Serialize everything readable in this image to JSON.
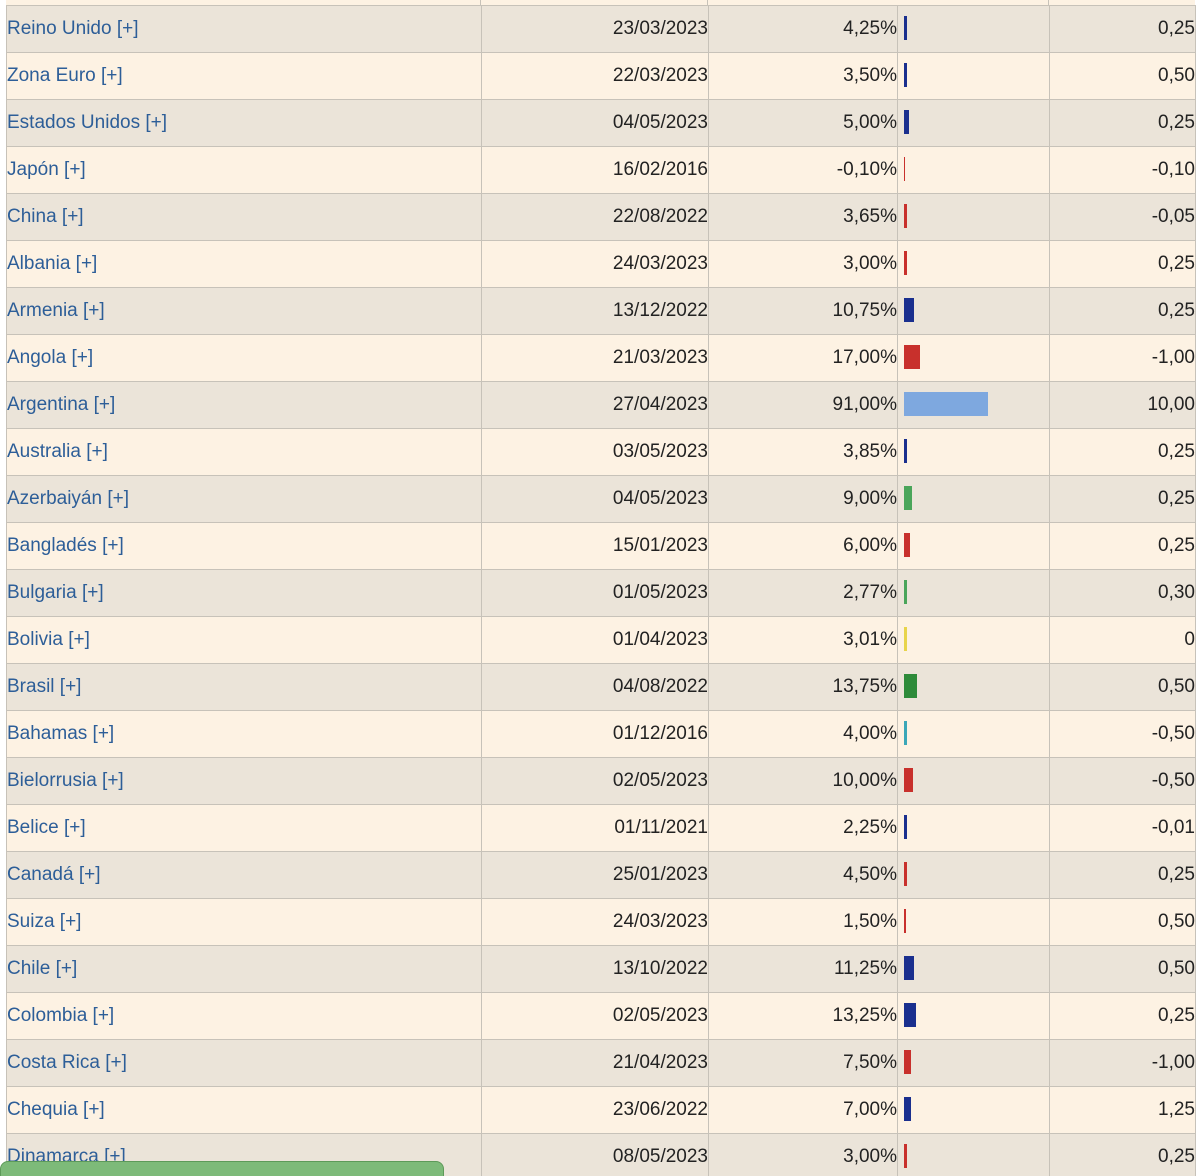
{
  "rows": [
    {
      "country": "Reino Unido [+]",
      "date": "23/03/2023",
      "rate": "4,25%",
      "rate_value": 4.25,
      "bar_color": "#1a2f8e",
      "change": "0,25",
      "dir": "pos"
    },
    {
      "country": "Zona Euro [+]",
      "date": "22/03/2023",
      "rate": "3,50%",
      "rate_value": 3.5,
      "bar_color": "#1a2f8e",
      "change": "0,50",
      "dir": "pos"
    },
    {
      "country": "Estados Unidos [+]",
      "date": "04/05/2023",
      "rate": "5,00%",
      "rate_value": 5.0,
      "bar_color": "#1a2f8e",
      "change": "0,25",
      "dir": "pos"
    },
    {
      "country": "Japón [+]",
      "date": "16/02/2016",
      "rate": "-0,10%",
      "rate_value": -0.1,
      "bar_color": "#c8302c",
      "change": "-0,10",
      "dir": "neg"
    },
    {
      "country": "China [+]",
      "date": "22/08/2022",
      "rate": "3,65%",
      "rate_value": 3.65,
      "bar_color": "#c8302c",
      "change": "-0,05",
      "dir": "neg"
    },
    {
      "country": "Albania [+]",
      "date": "24/03/2023",
      "rate": "3,00%",
      "rate_value": 3.0,
      "bar_color": "#c8302c",
      "change": "0,25",
      "dir": "pos"
    },
    {
      "country": "Armenia [+]",
      "date": "13/12/2022",
      "rate": "10,75%",
      "rate_value": 10.75,
      "bar_color": "#1a2f8e",
      "change": "0,25",
      "dir": "pos"
    },
    {
      "country": "Angola [+]",
      "date": "21/03/2023",
      "rate": "17,00%",
      "rate_value": 17.0,
      "bar_color": "#c8302c",
      "change": "-1,00",
      "dir": "neg"
    },
    {
      "country": "Argentina [+]",
      "date": "27/04/2023",
      "rate": "91,00%",
      "rate_value": 91.0,
      "bar_color": "#7ea8df",
      "change": "10,00",
      "dir": "pos"
    },
    {
      "country": "Australia [+]",
      "date": "03/05/2023",
      "rate": "3,85%",
      "rate_value": 3.85,
      "bar_color": "#1a2f8e",
      "change": "0,25",
      "dir": "pos"
    },
    {
      "country": "Azerbaiyán [+]",
      "date": "04/05/2023",
      "rate": "9,00%",
      "rate_value": 9.0,
      "bar_color": "#4aa55a",
      "change": "0,25",
      "dir": "pos"
    },
    {
      "country": "Bangladés [+]",
      "date": "15/01/2023",
      "rate": "6,00%",
      "rate_value": 6.0,
      "bar_color": "#c8302c",
      "change": "0,25",
      "dir": "pos"
    },
    {
      "country": "Bulgaria [+]",
      "date": "01/05/2023",
      "rate": "2,77%",
      "rate_value": 2.77,
      "bar_color": "#4aa55a",
      "change": "0,30",
      "dir": "pos"
    },
    {
      "country": "Bolivia [+]",
      "date": "01/04/2023",
      "rate": "3,01%",
      "rate_value": 3.01,
      "bar_color": "#e8d44a",
      "change": "0",
      "dir": "zero"
    },
    {
      "country": "Brasil [+]",
      "date": "04/08/2022",
      "rate": "13,75%",
      "rate_value": 13.75,
      "bar_color": "#2e8b3a",
      "change": "0,50",
      "dir": "pos"
    },
    {
      "country": "Bahamas [+]",
      "date": "01/12/2016",
      "rate": "4,00%",
      "rate_value": 4.0,
      "bar_color": "#3ba7b8",
      "change": "-0,50",
      "dir": "neg"
    },
    {
      "country": "Bielorrusia [+]",
      "date": "02/05/2023",
      "rate": "10,00%",
      "rate_value": 10.0,
      "bar_color": "#c8302c",
      "change": "-0,50",
      "dir": "neg"
    },
    {
      "country": "Belice [+]",
      "date": "01/11/2021",
      "rate": "2,25%",
      "rate_value": 2.25,
      "bar_color": "#1a2f8e",
      "change": "-0,01",
      "dir": "neg"
    },
    {
      "country": "Canadá [+]",
      "date": "25/01/2023",
      "rate": "4,50%",
      "rate_value": 4.5,
      "bar_color": "#c8302c",
      "change": "0,25",
      "dir": "pos"
    },
    {
      "country": "Suiza [+]",
      "date": "24/03/2023",
      "rate": "1,50%",
      "rate_value": 1.5,
      "bar_color": "#c8302c",
      "change": "0,50",
      "dir": "pos"
    },
    {
      "country": "Chile [+]",
      "date": "13/10/2022",
      "rate": "11,25%",
      "rate_value": 11.25,
      "bar_color": "#1a2f8e",
      "change": "0,50",
      "dir": "pos"
    },
    {
      "country": "Colombia [+]",
      "date": "02/05/2023",
      "rate": "13,25%",
      "rate_value": 13.25,
      "bar_color": "#1a2f8e",
      "change": "0,25",
      "dir": "pos"
    },
    {
      "country": "Costa Rica [+]",
      "date": "21/04/2023",
      "rate": "7,50%",
      "rate_value": 7.5,
      "bar_color": "#c8302c",
      "change": "-1,00",
      "dir": "neg"
    },
    {
      "country": "Chequia [+]",
      "date": "23/06/2022",
      "rate": "7,00%",
      "rate_value": 7.0,
      "bar_color": "#1a2f8e",
      "change": "1,25",
      "dir": "pos"
    },
    {
      "country": "Dinamarca [+]",
      "date": "08/05/2023",
      "rate": "3,00%",
      "rate_value": 3.0,
      "bar_color": "#c8302c",
      "change": "0,25",
      "dir": "pos"
    }
  ]
}
